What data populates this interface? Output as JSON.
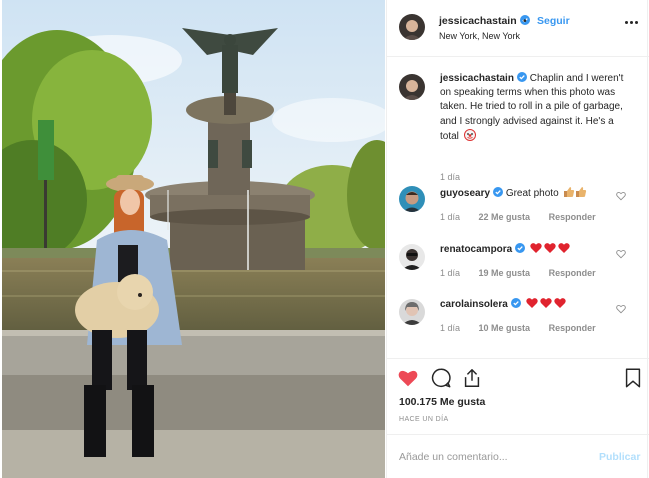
{
  "post_author": {
    "username": "jessicachastain",
    "verified": true,
    "follow_label": "Seguir",
    "separator": "•",
    "location": "New York, New York"
  },
  "photo": {
    "description_icon": "photo"
  },
  "caption": {
    "username": "jessicachastain",
    "text": "Chaplin and I weren't on speaking terms when this photo was taken. He tried to roll in a pile of garbage, and I strongly advised against it. He's a total",
    "emoji": "clown-face",
    "age": "1 día"
  },
  "comments": [
    {
      "username": "guyoseary",
      "verified": true,
      "text": "Great photo",
      "emoji": "thumbs-up x2",
      "age": "1 día",
      "likes": "22 Me gusta",
      "reply_label": "Responder"
    },
    {
      "username": "renatocampora",
      "verified": true,
      "text": "",
      "emoji": "red-heart x3",
      "age": "1 día",
      "likes": "19 Me gusta",
      "reply_label": "Responder"
    },
    {
      "username": "carolainsolera",
      "verified": true,
      "text": "",
      "emoji": "red-heart x3",
      "age": "1 día",
      "likes": "10 Me gusta",
      "reply_label": "Responder"
    }
  ],
  "actions": {
    "liked": true,
    "like_icon": "heart-filled-icon",
    "comment_icon": "comment-bubble-icon",
    "share_icon": "share-icon",
    "save_icon": "bookmark-icon"
  },
  "likes_count": "100.175 Me gusta",
  "time_ago": "HACE UN DÍA",
  "add_comment": {
    "placeholder": "Añade un comentario...",
    "publish_label": "Publicar"
  },
  "colors": {
    "accent": "#3897f0",
    "heart": "#ed4956",
    "muted": "#8e8e8e",
    "publish_disabled": "#b2dffc"
  }
}
